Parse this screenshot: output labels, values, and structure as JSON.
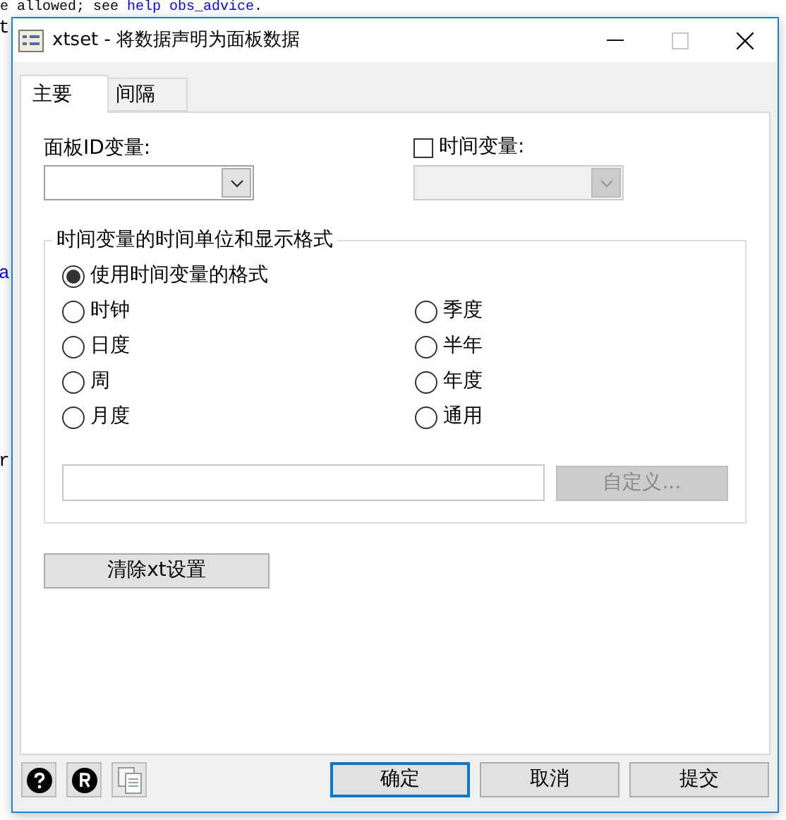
{
  "background": {
    "line": [
      {
        "text": "e allowed; see ",
        "kind": "plain"
      },
      {
        "text": "help obs_advice",
        "kind": "link"
      },
      {
        "text": ".",
        "kind": "plain"
      }
    ],
    "edge": [
      {
        "text": "t",
        "kind": "plain"
      },
      {
        "text": "a",
        "kind": "link"
      },
      {
        "text": "r",
        "kind": "plain"
      }
    ]
  },
  "window": {
    "title": "xtset - 将数据声明为面板数据"
  },
  "tabs": [
    {
      "label": "主要",
      "selected": true
    },
    {
      "label": "间隔",
      "selected": false
    }
  ],
  "panel_id": {
    "label": "面板ID变量:",
    "disabled": false
  },
  "time_var": {
    "label": "时间变量:",
    "checked": false,
    "disabled": true
  },
  "format_group": {
    "title": "时间变量的时间单位和显示格式",
    "options": [
      {
        "label": "使用时间变量的格式",
        "kind": "wide",
        "selected": true
      },
      {
        "label": "时钟",
        "kind": "grid",
        "selected": false
      },
      {
        "label": "季度",
        "kind": "grid",
        "selected": false
      },
      {
        "label": "日度",
        "kind": "grid",
        "selected": false
      },
      {
        "label": "半年",
        "kind": "grid",
        "selected": false
      },
      {
        "label": "周",
        "kind": "grid",
        "selected": false
      },
      {
        "label": "年度",
        "kind": "grid",
        "selected": false
      },
      {
        "label": "月度",
        "kind": "grid",
        "selected": false
      },
      {
        "label": "通用",
        "kind": "grid",
        "selected": false
      }
    ],
    "custom_button": {
      "label": "自定义...",
      "disabled": true
    }
  },
  "clear_button": "清除xt设置",
  "footer_buttons": [
    {
      "label": "确定",
      "default": true
    },
    {
      "label": "取消",
      "default": false
    },
    {
      "label": "提交",
      "default": false
    }
  ]
}
